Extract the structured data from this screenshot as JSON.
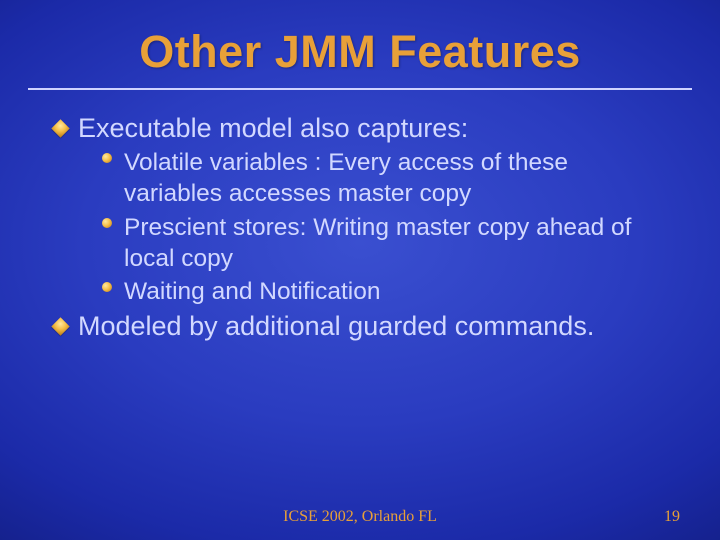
{
  "title": "Other JMM Features",
  "bullets": [
    {
      "text": "Executable model also captures:",
      "sub": [
        "Volatile variables : Every access of these variables accesses master copy",
        "Prescient stores: Writing master copy ahead of local copy",
        "Waiting and Notification"
      ]
    },
    {
      "text": "Modeled by additional guarded commands.",
      "sub": []
    }
  ],
  "footer": {
    "venue": "ICSE 2002, Orlando FL",
    "page": "19"
  }
}
